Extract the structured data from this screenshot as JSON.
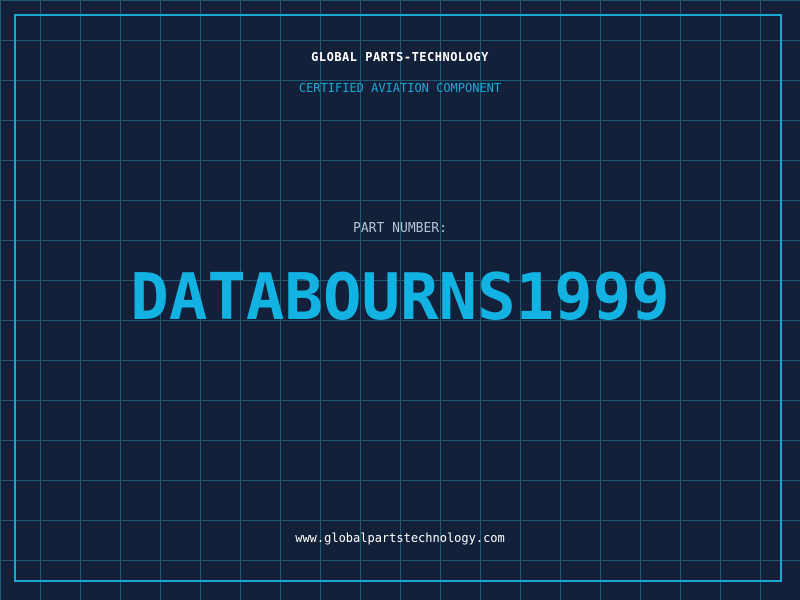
{
  "header": {
    "company": "GLOBAL PARTS-TECHNOLOGY",
    "tagline": "CERTIFIED AVIATION COMPONENT"
  },
  "part": {
    "label": "PART NUMBER:",
    "number": "DATABOURNS1999"
  },
  "footer": {
    "website": "www.globalpartstechnology.com"
  },
  "colors": {
    "background": "#13203a",
    "grid": "#1f5a72",
    "accent": "#12b3e2",
    "text": "#ffffff",
    "muted": "#b7c2d0"
  }
}
